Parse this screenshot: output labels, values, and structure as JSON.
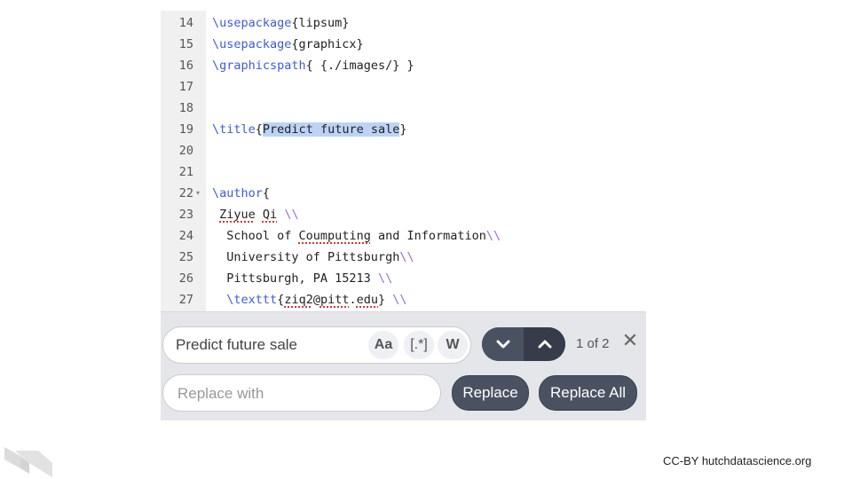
{
  "editor": {
    "lines": [
      {
        "num": "14",
        "segments": [
          {
            "t": "\\usepackage",
            "c": "kw"
          },
          {
            "t": "{lipsum}"
          }
        ]
      },
      {
        "num": "15",
        "segments": [
          {
            "t": "\\usepackage",
            "c": "kw"
          },
          {
            "t": "{graphicx}"
          }
        ]
      },
      {
        "num": "16",
        "segments": [
          {
            "t": "\\graphicspath",
            "c": "kw"
          },
          {
            "t": "{ {./images/} }"
          }
        ]
      },
      {
        "num": "17",
        "segments": []
      },
      {
        "num": "18",
        "segments": []
      },
      {
        "num": "19",
        "segments": [
          {
            "t": "\\title",
            "c": "kw"
          },
          {
            "t": "{"
          },
          {
            "t": "Predict future sale",
            "c": "sel"
          },
          {
            "t": "}"
          }
        ]
      },
      {
        "num": "20",
        "segments": []
      },
      {
        "num": "21",
        "segments": []
      },
      {
        "num": "22",
        "fold": "▾",
        "segments": [
          {
            "t": "\\author",
            "c": "kw"
          },
          {
            "t": "{"
          }
        ]
      },
      {
        "num": "23",
        "segments": [
          {
            "t": " "
          },
          {
            "t": "Ziyue",
            "c": "spell"
          },
          {
            "t": " "
          },
          {
            "t": "Qi",
            "c": "spell"
          },
          {
            "t": " "
          },
          {
            "t": "\\\\",
            "c": "sl"
          }
        ]
      },
      {
        "num": "24",
        "segments": [
          {
            "t": "  School of "
          },
          {
            "t": "Coumputing",
            "c": "spell"
          },
          {
            "t": " and Information"
          },
          {
            "t": "\\\\",
            "c": "sl"
          }
        ]
      },
      {
        "num": "25",
        "segments": [
          {
            "t": "  University of Pittsburgh"
          },
          {
            "t": "\\\\",
            "c": "sl"
          }
        ]
      },
      {
        "num": "26",
        "segments": [
          {
            "t": "  Pittsburgh, PA 15213 "
          },
          {
            "t": "\\\\",
            "c": "sl"
          }
        ]
      },
      {
        "num": "27",
        "segments": [
          {
            "t": "  "
          },
          {
            "t": "\\texttt",
            "c": "kw"
          },
          {
            "t": "{"
          },
          {
            "t": "ziq2",
            "c": "spell"
          },
          {
            "t": "@"
          },
          {
            "t": "pitt",
            "c": "spell"
          },
          {
            "t": "."
          },
          {
            "t": "edu",
            "c": "spell"
          },
          {
            "t": "} "
          },
          {
            "t": "\\\\",
            "c": "sl"
          }
        ]
      }
    ]
  },
  "find": {
    "search_value": "Predict future sale",
    "case_label": "Aa",
    "regex_label": "[.*]",
    "word_label": "W",
    "match_count": "1 of 2",
    "close_glyph": "✕",
    "replace_placeholder": "Replace with",
    "replace_label": "Replace",
    "replace_all_label": "Replace All"
  },
  "footer": {
    "credit": "CC-BY hutchdatascience.org"
  }
}
